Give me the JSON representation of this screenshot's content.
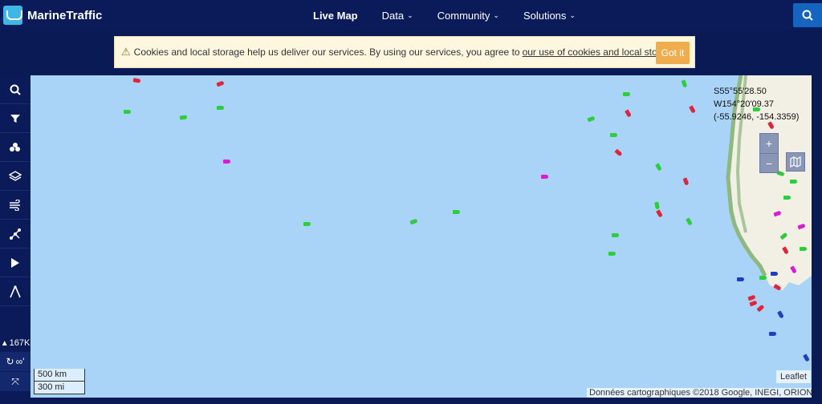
{
  "header": {
    "brand": "MarineTraffic",
    "nav": [
      {
        "label": "Live Map",
        "caret": ""
      },
      {
        "label": "Data",
        "caret": "⌄"
      },
      {
        "label": "Community",
        "caret": "⌄"
      },
      {
        "label": "Solutions",
        "caret": "⌄"
      }
    ]
  },
  "cookie": {
    "text_before": "Cookies and local storage help us deliver our services. By using our services, you agree to",
    "link": "our use of cookies and local storage",
    "text_after": ".",
    "button": "Got it"
  },
  "sidebar": {
    "icons": [
      "search-icon",
      "filter-icon",
      "density-icon",
      "layers-icon",
      "wind-icon",
      "route-icon",
      "play-icon",
      "measure-icon"
    ],
    "ship_count": "167K",
    "infinity_label": "∞'"
  },
  "map": {
    "coords": {
      "dms_lat": "S55°55'28.50",
      "dms_lon": "W154°20'09.37",
      "decimal": "(-55.9246, -154.3359)"
    },
    "zoom_in": "+",
    "zoom_out": "−",
    "scale_km": "500 km",
    "scale_mi": "300 mi",
    "attribution": "Données cartographiques ©2018 Google, INEGI, ORION",
    "leaflet": "Leaflet",
    "colors": {
      "ocean": "#a9d3f7",
      "land": "#f2efe4",
      "ship_green": "#2ecc40",
      "ship_red": "#e0243a",
      "ship_magenta": "#d61ed0",
      "ship_blue": "#1f3fbf"
    }
  }
}
